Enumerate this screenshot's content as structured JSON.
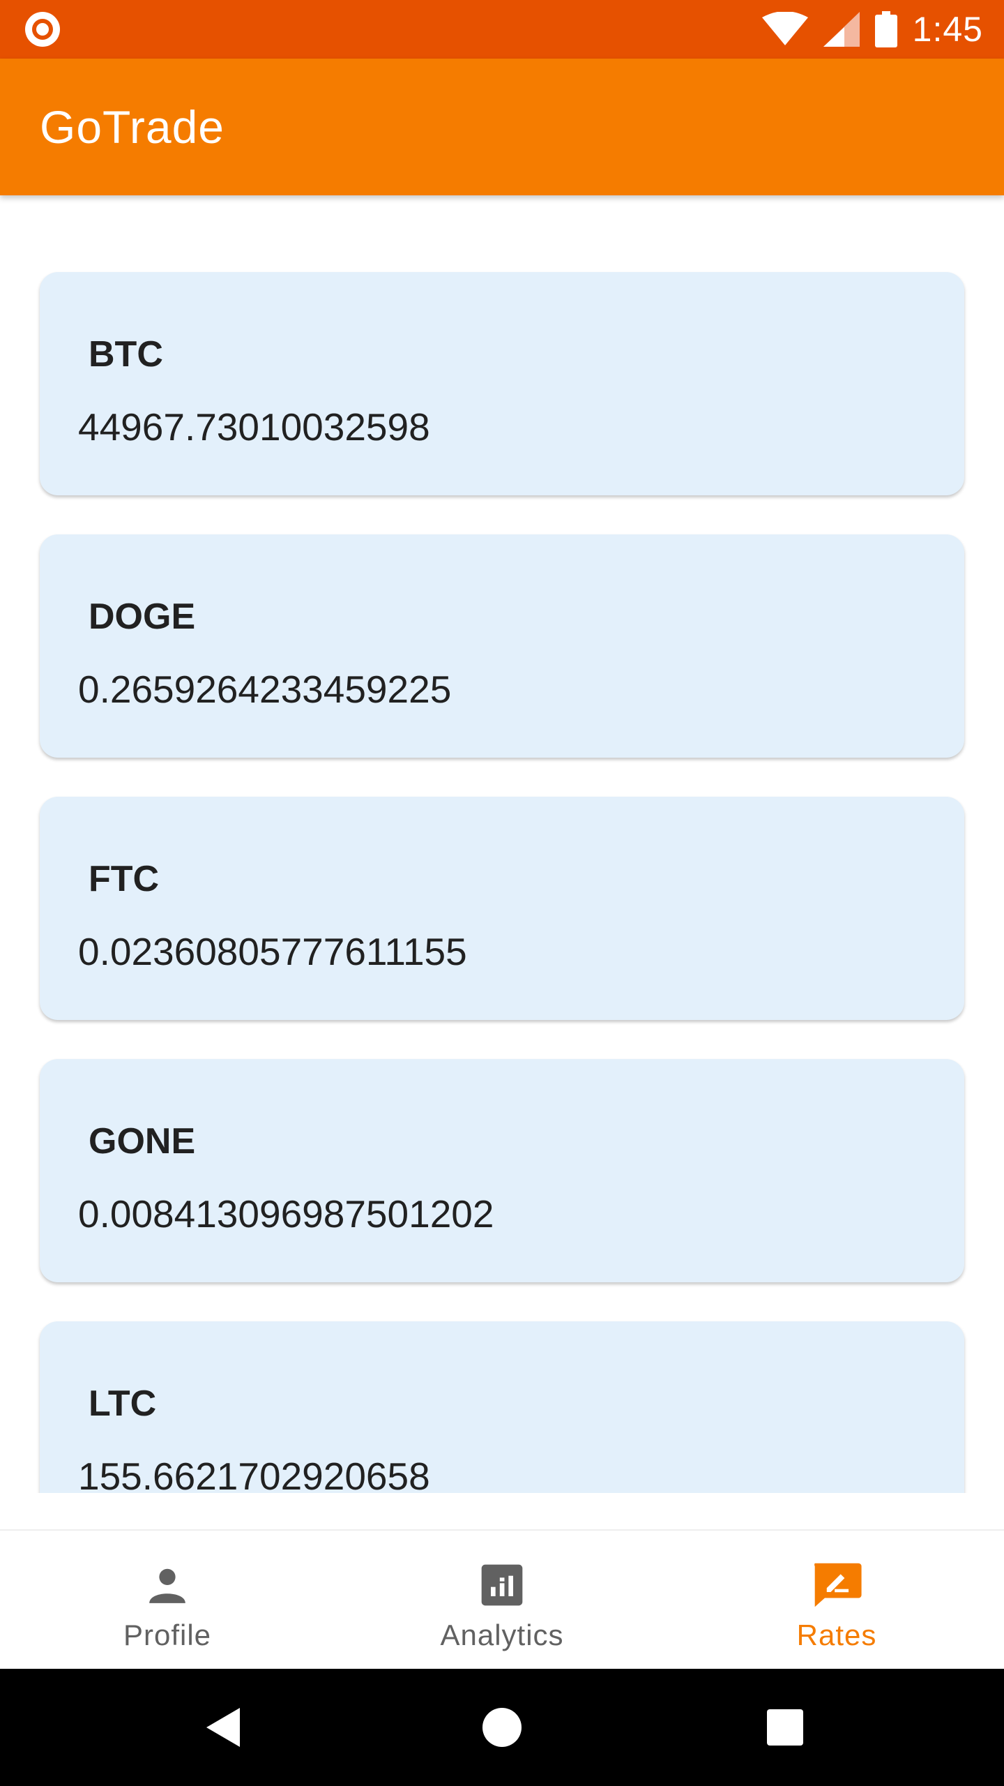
{
  "status_bar": {
    "time": "1:45",
    "icons": [
      "notification-dot-icon",
      "wifi-icon",
      "cell-signal-icon",
      "battery-icon"
    ]
  },
  "app_bar": {
    "title": "GoTrade"
  },
  "rates": [
    {
      "symbol": "BTC",
      "rate": "44967.73010032598"
    },
    {
      "symbol": "DOGE",
      "rate": "0.2659264233459225"
    },
    {
      "symbol": "FTC",
      "rate": "0.02360805777611155"
    },
    {
      "symbol": "GONE",
      "rate": "0.008413096987501202"
    },
    {
      "symbol": "LTC",
      "rate": "155.6621702920658"
    }
  ],
  "bottom_nav": {
    "items": [
      {
        "label": "Profile",
        "icon": "person-icon",
        "active": false
      },
      {
        "label": "Analytics",
        "icon": "analytics-icon",
        "active": false
      },
      {
        "label": "Rates",
        "icon": "rates-icon",
        "active": true
      }
    ]
  },
  "system_nav": {
    "icons": [
      "back-icon",
      "home-icon",
      "recents-icon"
    ]
  },
  "colors": {
    "status_bar": "#e65100",
    "app_bar": "#f57c00",
    "card_background": "#e3f0fb",
    "active_nav": "#f57c00",
    "inactive_nav": "#616161"
  }
}
